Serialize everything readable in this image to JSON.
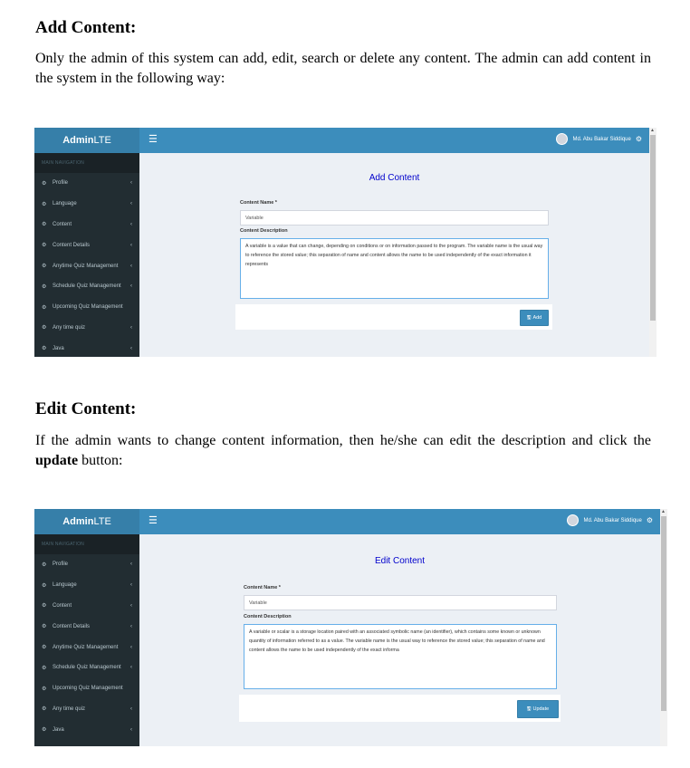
{
  "section1": {
    "heading": "Add Content:",
    "para": "Only the admin of this system can add, edit, search or delete any content. The admin can add content in the system in the following way:"
  },
  "section2": {
    "heading": "Edit Content:",
    "para_before": "If the admin wants to change content information, then he/she can edit the description and click the ",
    "para_bold": "update",
    "para_after": " button:"
  },
  "app": {
    "logo_bold": "Admin",
    "logo_rest": "LTE",
    "menu_icon": "hamburger-icon",
    "user_name": "Md. Abu Bakar Siddique",
    "nav_header": "MAIN NAVIGATION",
    "nav": [
      {
        "label": "Profile",
        "chevron": true
      },
      {
        "label": "Language",
        "chevron": true
      },
      {
        "label": "Content",
        "chevron": true
      },
      {
        "label": "Content Details",
        "chevron": true
      },
      {
        "label": "Anytime Quiz Management",
        "chevron": true
      },
      {
        "label": "Schedule Quiz Management",
        "chevron": true
      },
      {
        "label": "Upcoming Quiz Management",
        "chevron": false
      },
      {
        "label": "Any time quiz",
        "chevron": true
      },
      {
        "label": "Java",
        "chevron": true
      }
    ]
  },
  "add_form": {
    "title": "Add Content",
    "name_label": "Content Name *",
    "name_value": "Variable",
    "desc_label": "Content Description",
    "desc_value": "A variable is a value that can change, depending on conditions or on information passed to the program. The variable name is the usual way to reference the stored value; this separation of name and content allows the name to be used independently of the exact information it represents",
    "button": "Add"
  },
  "edit_form": {
    "title": "Edit Content",
    "name_label": "Content Name *",
    "name_value": "Variable",
    "desc_label": "Content Description",
    "desc_value": "A variable or scalar is a storage location paired with an associated symbolic name (an identifier), which contains some known or unknown quantity of information referred to as a value. The variable name is the usual way to reference the stored value; this separation of name and content allows the name to be used independently of the exact informa",
    "button": "Update"
  },
  "colors": {
    "topbar": "#3c8dbc",
    "sidebar": "#222d32",
    "title": "#0000cc"
  }
}
